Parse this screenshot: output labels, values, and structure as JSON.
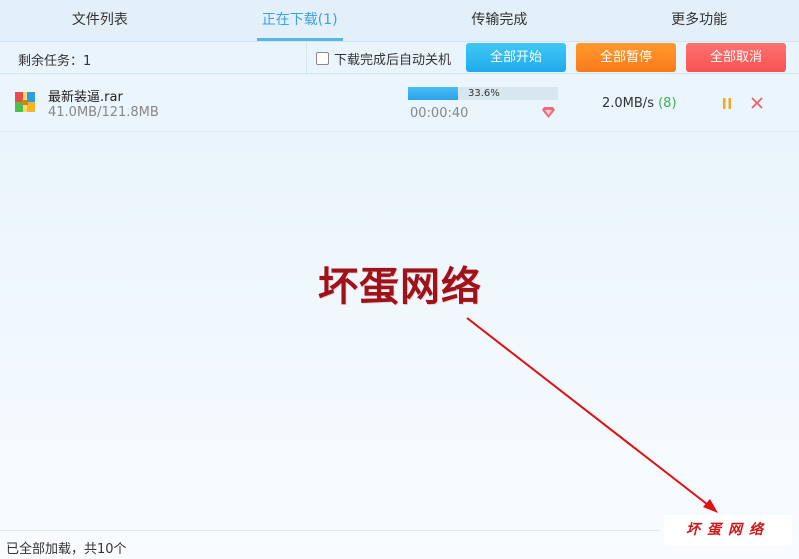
{
  "tabs": [
    {
      "label": "文件列表",
      "active": false
    },
    {
      "label": "正在下载(1)",
      "active": true
    },
    {
      "label": "传输完成",
      "active": false
    },
    {
      "label": "更多功能",
      "active": false
    }
  ],
  "toolbar": {
    "remaining_tasks": "剩余任务：1",
    "auto_shutdown_label": "下载完成后自动关机",
    "auto_shutdown_checked": false,
    "start_all": "全部开始",
    "pause_all": "全部暂停",
    "cancel_all": "全部取消"
  },
  "downloads": [
    {
      "name": "最新装逼.rar",
      "size": "41.0MB/121.8MB",
      "progress_text": "33.6%",
      "progress": 33.6,
      "elapsed": "00:00:40",
      "speed": "2.0MB/s",
      "connections": "(8)",
      "icons": [
        "archive-icon",
        "gem-icon",
        "pause-icon",
        "close-icon"
      ]
    }
  ],
  "watermark": {
    "large": "坏蛋网络",
    "small": "坏蛋网络"
  },
  "status": {
    "text": "已全部加载，共10个"
  },
  "colors": {
    "accent": "#3aa2e8",
    "start": "#21aaeb",
    "pause": "#f97a1a",
    "cancel": "#f85252",
    "connections": "#3fb24a",
    "watermark": "#a0121a"
  }
}
